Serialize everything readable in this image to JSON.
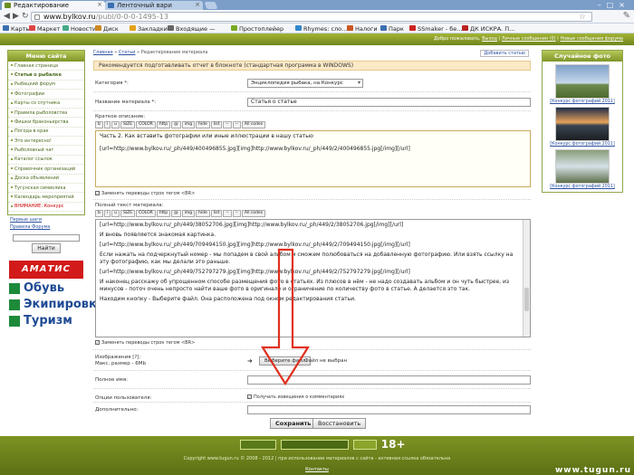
{
  "browser": {
    "tabs": [
      {
        "label": "Редактирование"
      },
      {
        "label": "Ленточный вари"
      }
    ],
    "url_host": "www.bylkov.ru",
    "url_path": "/publ/0-0-0-1495-13",
    "bookmarks": [
      "Карты",
      "Маркет",
      "Новости",
      "Диск",
      "Закладки",
      "Входящие —",
      "Простоплейер",
      "Rhymes: сло...",
      "Налоги",
      "Парк",
      "SSmaker - бе...",
      "ДК ИСКРА. П..."
    ]
  },
  "site": {
    "toplinks": [
      "Добро пожаловать,",
      "Выход",
      "Личные сообщения (0)",
      "Новые сообщения форума"
    ],
    "breadcrumb": [
      "Главная",
      "Статьи",
      "Редактирование материала"
    ],
    "add_article": "Добавить статью"
  },
  "leftmenu": {
    "title": "Меню сайта",
    "items": [
      "Главная страница",
      "Статьи о рыбалке",
      "Рыбацкий форум",
      "Фотографии",
      "Карты со спутника",
      "Правила рыболовства",
      "Фишки браконьерства",
      "Погода в крае",
      "Это интересно!",
      "Рыболовный чат",
      "Каталог ссылок",
      "Справочник организаций",
      "Доска объявлений",
      "Тугунская символика",
      "Календарь мероприятий",
      "ВНИМАНИЕ: Конкурс"
    ],
    "link1": "Первые шаги",
    "link2": "Правила Форума",
    "search_button": "Найти"
  },
  "ads": {
    "brand": "АМАТИС",
    "lines": [
      "Обувь",
      "Экипировка",
      "Туризм"
    ]
  },
  "form": {
    "notice": "Рекомендуется подготавливать отчет в блокноте (стандартная программа в WINDOWS)",
    "category_label": "Категория *:",
    "category_value": "Энциклопедия рыбака, на Конкурс",
    "title_label": "Название материала *:",
    "title_value": "Статья о статье",
    "short_label": "Краткое описание:",
    "toolbar": [
      "b",
      "i",
      "u",
      "SIZE",
      "COLOR",
      "http",
      "@",
      "img",
      "hide",
      "list",
      "--",
      "--",
      "All codes"
    ],
    "short_text": [
      "Часть 2. Как вставить фотографии или иные иллюстрации в нашу статью",
      "[url=http://www.bylkov.ru/_ph/449/400496855.jpg][img]http://www.bylkov.ru/_ph/449/2/400496855.jpg[/img][/url]"
    ],
    "replace_breaks": "Заменять переводы строк тегом <BR>",
    "full_label": "Полный текст материала:",
    "full_text": [
      "[url=http://www.bylkov.ru/_ph/449/38052706.jpg][img]http://www.bylkov.ru/_ph/449/2/38052706.jpg[/img][/url]",
      "И вновь появляется знакомая картинка.",
      "[url=http://www.bylkov.ru/_ph/449/709494150.jpg][img]http://www.bylkov.ru/_ph/449/2/709494150.jpg[/img][/url]",
      "Если нажать на подчеркнутый номер - мы попадем в свой альбом и сможем полюбоваться на добавленную фотографию. Или взять ссылку на эту фотографию, как мы делали это раньше.",
      "[url=http://www.bylkov.ru/_ph/449/752797279.jpg][img]http://www.bylkov.ru/_ph/449/2/752797279.jpg[/img][/url]",
      "И наконец расскажу об упрощенном способе размещения фото в статьях. Из плюсов в нём - не надо создавать альбом и он чуть быстрее, из минусов - поточ очень непросто найти ваше фото в оригинале и ограничение по количеству фото в статье. А делается это так.",
      "Находим кнопку - Выберите файл. Она расположена под окном редактирования статьи."
    ],
    "images_label": "Изображения [?]:",
    "images_size": "Макс. размер - 6Mb",
    "file_button": "Выберите файл",
    "file_status": "Файл не выбран",
    "author_label": "Полное имя:",
    "options_label": "Опции пользователя:",
    "notify_label": "Получать извещения о комментариях",
    "extra_label": "Дополнительно:",
    "save_button": "Сохранить",
    "restore_button": "Восстановить"
  },
  "rightcol": {
    "title": "Случайное фото",
    "captions": [
      "[Конкурс фотографий 2011]",
      "[Конкурс фотографий 2011]",
      "[Конкурс фотографий 2011]"
    ]
  },
  "footer": {
    "copyright": "Copyright www.tugun.ru © 2008 - 2012 | при использовании материалов с сайта - активная ссылка обязательна",
    "contacts": "Контакты",
    "age": "18+",
    "watermark": "www.tugun.ru"
  },
  "colors": {
    "green": "#7e9527",
    "notice": "#fbe9c7",
    "link": "#2a4fa0",
    "arrow": "#e0301e"
  }
}
